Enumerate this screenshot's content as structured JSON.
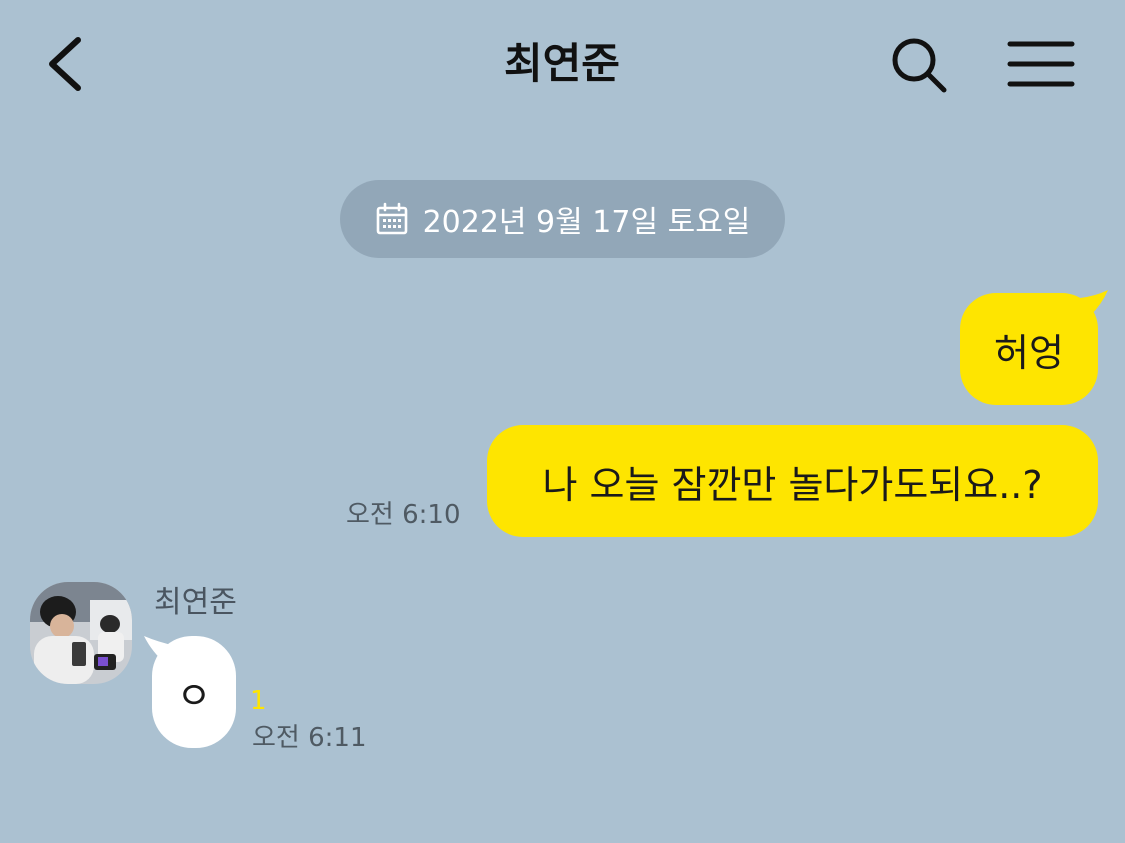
{
  "header": {
    "title": "최연준",
    "back_icon": "chevron-left-icon",
    "search_icon": "search-icon",
    "menu_icon": "hamburger-menu-icon"
  },
  "date_divider": {
    "icon": "calendar-icon",
    "text": "2022년 9월 17일 토요일"
  },
  "messages": [
    {
      "from": "me",
      "text": "허엉"
    },
    {
      "from": "me",
      "text": "나 오늘 잠깐만 놀다가도되요..?",
      "time": "오전 6:10"
    },
    {
      "from": "other",
      "sender": "최연준",
      "text": "ㅇ",
      "unread": "1",
      "time": "오전 6:11"
    }
  ],
  "colors": {
    "background": "#abc1d1",
    "my_bubble": "#fee500",
    "other_bubble": "#ffffff",
    "date_pill": "#92a7b8",
    "unread_count": "#fee500"
  }
}
